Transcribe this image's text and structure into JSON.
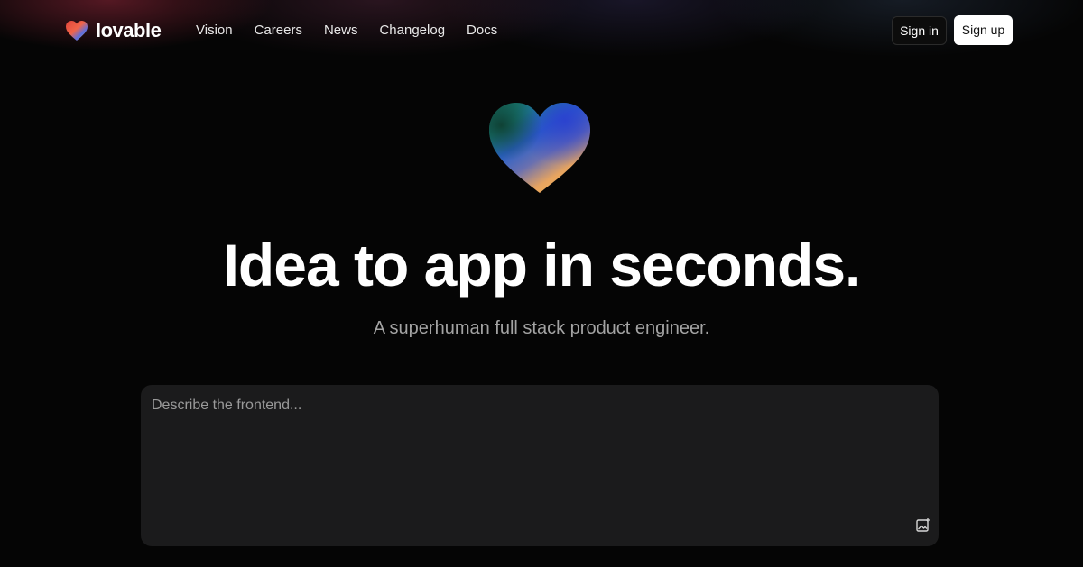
{
  "brand": {
    "name": "lovable"
  },
  "nav": {
    "items": [
      {
        "label": "Vision"
      },
      {
        "label": "Careers"
      },
      {
        "label": "News"
      },
      {
        "label": "Changelog"
      },
      {
        "label": "Docs"
      }
    ]
  },
  "auth": {
    "signin_label": "Sign in",
    "signup_label": "Sign up"
  },
  "hero": {
    "headline": "Idea to app in seconds.",
    "subheadline": "A superhuman full stack product engineer."
  },
  "prompt": {
    "placeholder": "Describe the frontend...",
    "attach_icon": "image-attach-icon"
  },
  "colors": {
    "background": "#050505",
    "prompt_bg": "#1b1b1c",
    "subtext": "#a3a3a3",
    "signup_bg": "#ffffff"
  }
}
